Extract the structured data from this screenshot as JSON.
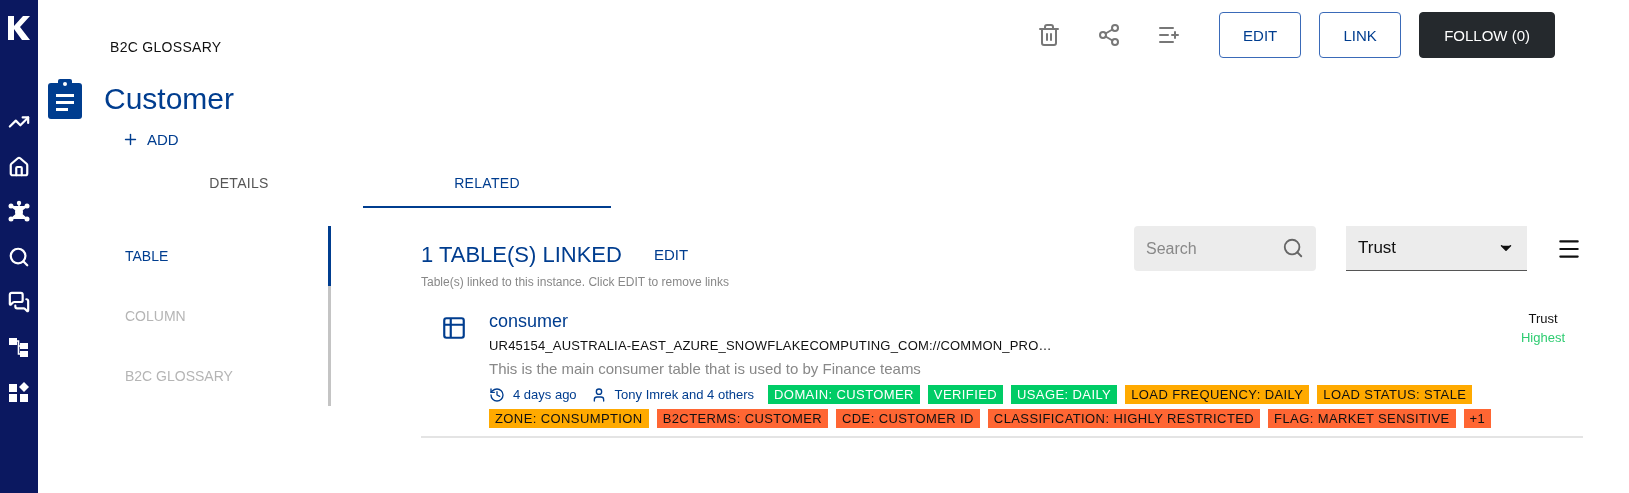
{
  "breadcrumb": "B2C GLOSSARY",
  "title": "Customer",
  "add_label": "ADD",
  "toolbar": {
    "buttons": [
      {
        "label": "EDIT",
        "kind": "outline"
      },
      {
        "label": "LINK",
        "kind": "outline"
      },
      {
        "label": "FOLLOW (0)",
        "kind": "filled"
      }
    ]
  },
  "tabs": [
    {
      "label": "DETAILS",
      "selected": false
    },
    {
      "label": "RELATED",
      "selected": true
    }
  ],
  "side_nav": [
    {
      "label": "TABLE",
      "selected": true
    },
    {
      "label": "COLUMN",
      "selected": false
    },
    {
      "label": "B2C GLOSSARY",
      "selected": false
    }
  ],
  "section": {
    "heading": "1 TABLE(S) LINKED",
    "edit_label": "EDIT",
    "hint": "Table(s) linked to this instance. Click EDIT to remove links",
    "search": {
      "placeholder": "Search"
    },
    "sort": {
      "value": "Trust"
    }
  },
  "results": [
    {
      "name": "consumer",
      "path": "UR45154_AUSTRALIA-EAST_AZURE_SNOWFLAKECOMPUTING_COM://COMMON_PRO…",
      "description": "This is the main consumer table that is used to by Finance teams",
      "updated": "4 days ago",
      "owners": "Tony Imrek and 4 others",
      "trust_label": "Trust",
      "trust_value": "Highest",
      "tags": [
        {
          "label": "DOMAIN: CUSTOMER",
          "color": "#00cc66"
        },
        {
          "label": "VERIFIED",
          "color": "#00cc66"
        },
        {
          "label": "USAGE: DAILY",
          "color": "#00cc66"
        },
        {
          "label": "LOAD FREQUENCY: DAILY",
          "color": "#ffaa00"
        },
        {
          "label": "LOAD STATUS: STALE",
          "color": "#ffaa00"
        },
        {
          "label": "ZONE: CONSUMPTION",
          "color": "#ffaa00"
        },
        {
          "label": "B2CTERMS: CUSTOMER",
          "color": "#ff6633"
        },
        {
          "label": "CDE: CUSTOMER ID",
          "color": "#ff6633"
        },
        {
          "label": "CLASSIFICATION: HIGHLY RESTRICTED",
          "color": "#ff6633"
        },
        {
          "label": "FLAG: MARKET SENSITIVE",
          "color": "#ff6633"
        },
        {
          "label": "+1",
          "color": "#ff6633"
        }
      ]
    }
  ]
}
